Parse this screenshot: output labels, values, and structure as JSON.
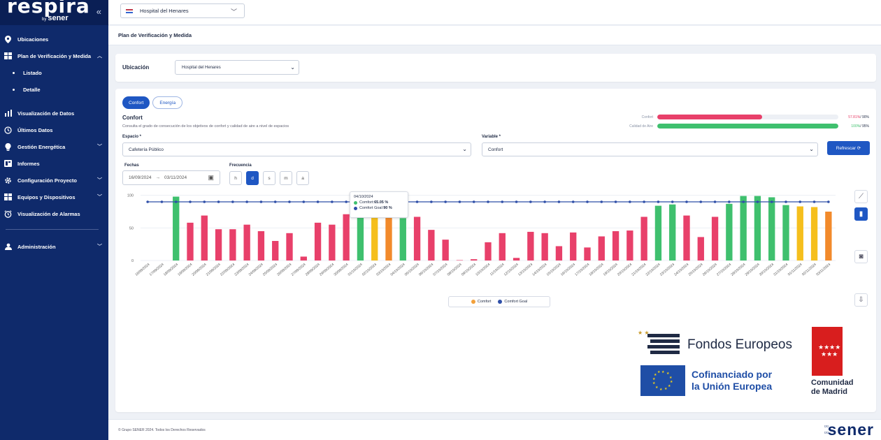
{
  "app": {
    "brand": "respira",
    "by": "by",
    "by_company": "sener",
    "collapse_label": "«"
  },
  "sidebar": {
    "items": [
      {
        "label": "Ubicaciones",
        "icon": "location-pin-icon"
      },
      {
        "label": "Plan de Verificación y Medida",
        "icon": "grid-icon",
        "expanded": true
      },
      {
        "label": "Listado",
        "sub": true
      },
      {
        "label": "Detalle",
        "sub": true,
        "active": true
      },
      {
        "label": "Visualización de Datos",
        "icon": "bar-chart-icon"
      },
      {
        "label": "Últimos Datos",
        "icon": "clock-icon"
      },
      {
        "label": "Gestión Energética",
        "icon": "bulb-icon"
      },
      {
        "label": "Informes",
        "icon": "report-icon"
      },
      {
        "label": "Configuración Proyecto",
        "icon": "gear-icon"
      },
      {
        "label": "Equipos y Dispositivos",
        "icon": "devices-icon"
      },
      {
        "label": "Visualización de Alarmas",
        "icon": "alarm-icon"
      },
      {
        "label": "Administración",
        "icon": "user-icon"
      }
    ]
  },
  "topbar": {
    "hospital": "Hospital del Henares"
  },
  "breadcrumb": "Plan de Verificación y Medida",
  "location": {
    "label": "Ubicación",
    "value": "Hospital del Henares"
  },
  "tabs": [
    "Confort",
    "Energía"
  ],
  "section": {
    "title": "Confort",
    "description": "Consulta el grado de consecución de los objetivos de confort y calidad de aire a nivel de espacios"
  },
  "progress": [
    {
      "label": "Confort",
      "value": "57.81%",
      "goal": "/ 90%",
      "fraction": 0.5781,
      "color": "#e8406a"
    },
    {
      "label": "Calidad de Aire",
      "value": "100%",
      "goal": "/ 95%",
      "fraction": 1.0,
      "color": "#3fc06e"
    }
  ],
  "filters": {
    "space_label": "Espacio *",
    "space_value": "Cafetería Público",
    "variable_label": "Variable *",
    "variable_value": "Confort",
    "refresh_label": "Refrescar ⟳",
    "dates_label": "Fechas",
    "date_from": "16/09/2024",
    "date_arrow": "→",
    "date_to": "03/11/2024",
    "freq_label": "Frecuencia",
    "freq_options": [
      "h",
      "d",
      "s",
      "m",
      "a"
    ],
    "freq_selected": "d"
  },
  "tooltip": {
    "date": "04/10/2024",
    "rows": [
      {
        "label": "Comfort: ",
        "value": "65.05 %",
        "color": "#3fc06e"
      },
      {
        "label": "Comfort Goal: ",
        "value": "90 %",
        "color": "#2f4fa8"
      }
    ]
  },
  "legend": [
    {
      "label": "Comfort",
      "color": "#f2a03b"
    },
    {
      "label": "Comfort Goal",
      "color": "#2f4fa8"
    }
  ],
  "chart_data": {
    "type": "bar",
    "yticks": [
      0,
      50,
      100
    ],
    "ylim": [
      0,
      105
    ],
    "goal": 90,
    "categories": [
      "16/09/2024",
      "17/09/2024",
      "18/09/2024",
      "19/09/2024",
      "20/09/2024",
      "21/09/2024",
      "22/09/2024",
      "23/09/2024",
      "24/09/2024",
      "25/09/2024",
      "26/09/2024",
      "27/09/2024",
      "28/09/2024",
      "29/09/2024",
      "30/09/2024",
      "01/10/2024",
      "02/10/2024",
      "03/10/2024",
      "04/10/2024",
      "05/10/2024",
      "06/10/2024",
      "07/10/2024",
      "08/10/2024",
      "09/10/2024",
      "10/10/2024",
      "11/10/2024",
      "12/10/2024",
      "13/10/2024",
      "14/10/2024",
      "15/10/2024",
      "16/10/2024",
      "17/10/2024",
      "18/10/2024",
      "19/10/2024",
      "20/10/2024",
      "21/10/2024",
      "22/10/2024",
      "23/10/2024",
      "24/10/2024",
      "25/10/2024",
      "26/10/2024",
      "27/10/2024",
      "28/10/2024",
      "29/10/2024",
      "30/10/2024",
      "31/10/2024",
      "01/11/2024",
      "02/11/2024",
      "03/11/2024"
    ],
    "values": [
      null,
      null,
      98,
      58,
      69,
      48,
      48,
      55,
      45,
      30,
      42,
      6,
      58,
      55,
      71,
      88,
      68,
      78,
      65,
      67,
      47,
      32,
      0,
      2,
      28,
      42,
      4,
      44,
      42,
      22,
      43,
      20,
      37,
      45,
      46,
      67,
      84,
      86,
      69,
      36,
      67,
      87,
      99,
      99,
      97,
      85,
      83,
      82,
      75
    ],
    "colors": [
      "",
      "",
      "#3fc06e",
      "#e8406a",
      "#e8406a",
      "#e8406a",
      "#e8406a",
      "#e8406a",
      "#e8406a",
      "#e8406a",
      "#e8406a",
      "#e8406a",
      "#e8406a",
      "#e8406a",
      "#e8406a",
      "#3fc06e",
      "#f5bf1d",
      "#f28a2b",
      "#3fc06e",
      "#e8406a",
      "#e8406a",
      "#e8406a",
      "#e8406a",
      "#e8406a",
      "#e8406a",
      "#e8406a",
      "#e8406a",
      "#e8406a",
      "#e8406a",
      "#e8406a",
      "#e8406a",
      "#e8406a",
      "#e8406a",
      "#e8406a",
      "#e8406a",
      "#e8406a",
      "#3fc06e",
      "#3fc06e",
      "#e8406a",
      "#e8406a",
      "#e8406a",
      "#3fc06e",
      "#3fc06e",
      "#3fc06e",
      "#3fc06e",
      "#3fc06e",
      "#f5bf1d",
      "#f5bf1d",
      "#f28a2b"
    ]
  },
  "funding": {
    "fondos": "Fondos Europeos",
    "eu_line1": "Cofinanciado por",
    "eu_line2": "la Unión Europea",
    "madrid_line1": "Comunidad",
    "madrid_line2": "de Madrid"
  },
  "footer": {
    "copyright": "© Grupo SENER 2024. Todos los Derechos Reservados",
    "brand": "sener"
  },
  "colors": {
    "primary": "#1f57c3",
    "sidebar": "#0f2a6b",
    "red": "#e8406a",
    "green": "#3fc06e",
    "yellow": "#f5bf1d",
    "orange": "#f28a2b",
    "goal": "#2f4fa8"
  }
}
